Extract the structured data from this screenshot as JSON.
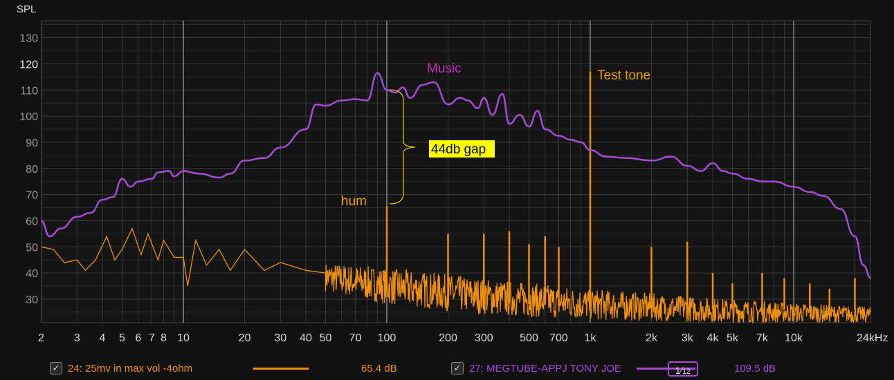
{
  "chart_data": {
    "type": "line",
    "ylabel": "SPL",
    "ylim": [
      21,
      136.5
    ],
    "xlim": [
      2,
      24000
    ],
    "xscale": "log",
    "yticks": [
      30,
      40,
      50,
      60,
      70,
      80,
      90,
      100,
      110,
      120,
      130
    ],
    "xticks": [
      {
        "v": 2,
        "l": "2"
      },
      {
        "v": 3,
        "l": "3"
      },
      {
        "v": 4,
        "l": "4"
      },
      {
        "v": 5,
        "l": "5"
      },
      {
        "v": 6,
        "l": "6"
      },
      {
        "v": 7,
        "l": "7"
      },
      {
        "v": 8,
        "l": "8"
      },
      {
        "v": 10,
        "l": "10"
      },
      {
        "v": 20,
        "l": "20"
      },
      {
        "v": 30,
        "l": "30"
      },
      {
        "v": 40,
        "l": "40"
      },
      {
        "v": 50,
        "l": "50"
      },
      {
        "v": 70,
        "l": "70"
      },
      {
        "v": 100,
        "l": "100"
      },
      {
        "v": 200,
        "l": "200"
      },
      {
        "v": 300,
        "l": "300"
      },
      {
        "v": 500,
        "l": "500"
      },
      {
        "v": 700,
        "l": "700"
      },
      {
        "v": 1000,
        "l": "1k"
      },
      {
        "v": 2000,
        "l": "2k"
      },
      {
        "v": 3000,
        "l": "3k"
      },
      {
        "v": 4000,
        "l": "4k"
      },
      {
        "v": 5000,
        "l": "5k"
      },
      {
        "v": 7000,
        "l": "7k"
      },
      {
        "v": 10000,
        "l": "10k"
      },
      {
        "v": 24000,
        "l": "24kHz"
      }
    ],
    "grid": true,
    "series": [
      {
        "name": "27: MEGTUBE-APPJ TONY JOE",
        "color": "#a64ad8",
        "points": [
          [
            2,
            60
          ],
          [
            2.2,
            54
          ],
          [
            2.5,
            57
          ],
          [
            3,
            61.5
          ],
          [
            3.5,
            63
          ],
          [
            4,
            68
          ],
          [
            4.5,
            69
          ],
          [
            5,
            76
          ],
          [
            5.5,
            73
          ],
          [
            6,
            75
          ],
          [
            7,
            76
          ],
          [
            7.5,
            78.5
          ],
          [
            8.5,
            79
          ],
          [
            9,
            77
          ],
          [
            10,
            79
          ],
          [
            12,
            78
          ],
          [
            15,
            76.5
          ],
          [
            17,
            78
          ],
          [
            20,
            83
          ],
          [
            25,
            84
          ],
          [
            30,
            88
          ],
          [
            40,
            95
          ],
          [
            45,
            104.5
          ],
          [
            50,
            104
          ],
          [
            60,
            106
          ],
          [
            70,
            106.5
          ],
          [
            80,
            106
          ],
          [
            90,
            116.5
          ],
          [
            100,
            110
          ],
          [
            110,
            109
          ],
          [
            120,
            111
          ],
          [
            130,
            107
          ],
          [
            150,
            112
          ],
          [
            170,
            113
          ],
          [
            200,
            104.5
          ],
          [
            230,
            107
          ],
          [
            250,
            106
          ],
          [
            280,
            103
          ],
          [
            300,
            107
          ],
          [
            330,
            100.5
          ],
          [
            370,
            108.5
          ],
          [
            400,
            97
          ],
          [
            450,
            100.5
          ],
          [
            500,
            96
          ],
          [
            550,
            102
          ],
          [
            600,
            95
          ],
          [
            700,
            92.5
          ],
          [
            800,
            91
          ],
          [
            900,
            90
          ],
          [
            1000,
            87
          ],
          [
            1200,
            84.5
          ],
          [
            1500,
            84
          ],
          [
            2000,
            83
          ],
          [
            2500,
            84.5
          ],
          [
            3000,
            81
          ],
          [
            3500,
            79
          ],
          [
            4000,
            82
          ],
          [
            4500,
            79
          ],
          [
            5000,
            78
          ],
          [
            6000,
            76
          ],
          [
            7000,
            75
          ],
          [
            8000,
            75
          ],
          [
            10000,
            73
          ],
          [
            12000,
            71
          ],
          [
            14000,
            69.5
          ],
          [
            17000,
            64.5
          ],
          [
            20000,
            54
          ],
          [
            22000,
            43
          ],
          [
            24000,
            38
          ]
        ]
      },
      {
        "name": "24: 25mv in max vol -4ohm",
        "color": "#f0900a",
        "points": [
          [
            2,
            50
          ],
          [
            2.3,
            49
          ],
          [
            2.6,
            44
          ],
          [
            3,
            45
          ],
          [
            3.3,
            41
          ],
          [
            3.7,
            45
          ],
          [
            4.2,
            54
          ],
          [
            4.6,
            45
          ],
          [
            5,
            49
          ],
          [
            5.6,
            57
          ],
          [
            6.2,
            47
          ],
          [
            6.7,
            55
          ],
          [
            7.5,
            45
          ],
          [
            8,
            52.5
          ],
          [
            9,
            46
          ],
          [
            10,
            46
          ],
          [
            10.5,
            35
          ],
          [
            11.5,
            52.5
          ],
          [
            13,
            43
          ],
          [
            15,
            49
          ],
          [
            17,
            41
          ],
          [
            20,
            49
          ],
          [
            25,
            41
          ],
          [
            30,
            44
          ],
          [
            40,
            41
          ],
          [
            50,
            40
          ]
        ],
        "noise_floor": [
          [
            50,
            33,
            44
          ],
          [
            100,
            28,
            42
          ],
          [
            300,
            24,
            38
          ],
          [
            1000,
            22,
            34
          ],
          [
            5000,
            21,
            30
          ],
          [
            24000,
            21,
            27
          ]
        ],
        "spikes": [
          [
            100,
            65.5
          ],
          [
            200,
            55
          ],
          [
            300,
            55
          ],
          [
            400,
            56
          ],
          [
            500,
            51
          ],
          [
            600,
            54
          ],
          [
            700,
            50
          ],
          [
            1000,
            117
          ],
          [
            2000,
            50
          ],
          [
            3000,
            52
          ],
          [
            4000,
            40
          ],
          [
            5000,
            36
          ],
          [
            7000,
            40
          ],
          [
            9000,
            38
          ],
          [
            12000,
            36
          ],
          [
            15000,
            34
          ],
          [
            20000,
            38
          ]
        ]
      }
    ],
    "annotations": {
      "music": "Music",
      "test_tone": "Test tone",
      "hum": "hum",
      "gap": "44db gap"
    }
  },
  "legend": [
    {
      "label": "24: 25mv in max vol -4ohm",
      "value": "65.4 dB",
      "checked": "✓"
    },
    {
      "label": "27: MEGTUBE-APPJ TONY JOE",
      "value": "109.5 dB",
      "checked": "✓",
      "smoothing_num": "1",
      "smoothing_den": "12"
    }
  ]
}
